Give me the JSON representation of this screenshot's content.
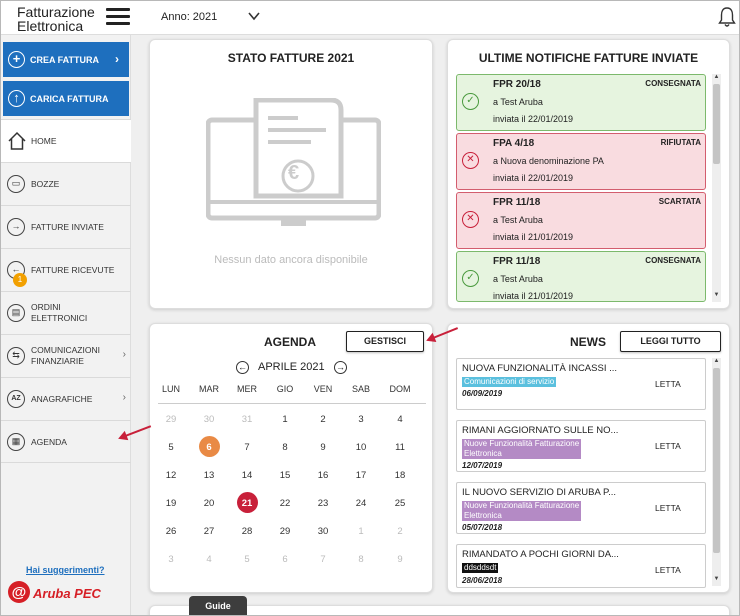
{
  "header": {
    "brand_line1": "Fatturazione",
    "brand_line2": "Elettronica",
    "year_label": "Anno: 2021"
  },
  "sidebar": {
    "create_label": "CREA FATTURA",
    "upload_label": "CARICA FATTURA",
    "items": [
      {
        "label": "HOME"
      },
      {
        "label": "BOZZE"
      },
      {
        "label": "FATTURE INVIATE"
      },
      {
        "label": "FATTURE RICEVUTE",
        "badge": "1"
      },
      {
        "label_line1": "ORDINI",
        "label_line2": "ELETTRONICI"
      },
      {
        "label_line1": "COMUNICAZIONI",
        "label_line2": "FINANZIARIE"
      },
      {
        "label": "ANAGRAFICHE"
      },
      {
        "label": "AGENDA"
      }
    ],
    "suggestions": "Hai suggerimenti?",
    "logo_text": "Aruba PEC"
  },
  "stato": {
    "title": "STATO FATTURE 2021",
    "empty": "Nessun dato ancora disponibile",
    "euro": "€"
  },
  "notifiche": {
    "title": "ULTIME NOTIFICHE FATTURE INVIATE",
    "items": [
      {
        "code": "FPR 20/18",
        "to": "a Test Aruba",
        "date": "inviata il 22/01/2019",
        "status": "CONSEGNATA"
      },
      {
        "code": "FPA 4/18",
        "to": "a Nuova denominazione PA",
        "date": "inviata il 22/01/2019",
        "status": "RIFIUTATA"
      },
      {
        "code": "FPR 11/18",
        "to": "a Test Aruba",
        "date": "inviata il 21/01/2019",
        "status": "SCARTATA"
      },
      {
        "code": "FPR 11/18",
        "to": "a Test Aruba",
        "date": "inviata il 21/01/2019",
        "status": "CONSEGNATA"
      }
    ]
  },
  "agenda": {
    "title": "AGENDA",
    "manage": "GESTISCI",
    "month": "APRILE 2021",
    "weekdays": [
      "LUN",
      "MAR",
      "MER",
      "GIO",
      "VEN",
      "SAB",
      "DOM"
    ],
    "weeks": [
      [
        "29",
        "30",
        "31",
        "1",
        "2",
        "3",
        "4"
      ],
      [
        "5",
        "6",
        "7",
        "8",
        "9",
        "10",
        "11"
      ],
      [
        "12",
        "13",
        "14",
        "15",
        "16",
        "17",
        "18"
      ],
      [
        "19",
        "20",
        "21",
        "22",
        "23",
        "24",
        "25"
      ],
      [
        "26",
        "27",
        "28",
        "29",
        "30",
        "1",
        "2"
      ],
      [
        "3",
        "4",
        "5",
        "6",
        "7",
        "8",
        "9"
      ]
    ],
    "today": "6",
    "selected": "21"
  },
  "news": {
    "title": "NEWS",
    "read_all": "LEGGI TUTTO",
    "items": [
      {
        "title": "NUOVA FUNZIONALITÀ INCASSI ...",
        "tag_line1": "Comunicazioni di servizio",
        "tag_line2": "",
        "date": "06/09/2019",
        "state": "LETTA",
        "tag_color": "#5bc0de"
      },
      {
        "title": "RIMANI AGGIORNATO SULLE NO...",
        "tag_line1": "Nuove Funzionalità Fatturazione",
        "tag_line2": "Elettronica",
        "date": "12/07/2019",
        "state": "LETTA",
        "tag_color": "#b48ac5"
      },
      {
        "title": "IL NUOVO SERVIZIO DI ARUBA P...",
        "tag_line1": "Nuove Funzionalità Fatturazione",
        "tag_line2": "Elettronica",
        "date": "05/07/2018",
        "state": "LETTA",
        "tag_color": "#b48ac5"
      },
      {
        "title": "RIMANDATO A POCHI GIORNI DA...",
        "tag_line1": "ddsddsdt",
        "tag_line2": "",
        "date": "28/06/2018",
        "state": "LETTA",
        "tag_color": "#111111"
      }
    ]
  },
  "footer": {
    "guide": "Guide"
  }
}
